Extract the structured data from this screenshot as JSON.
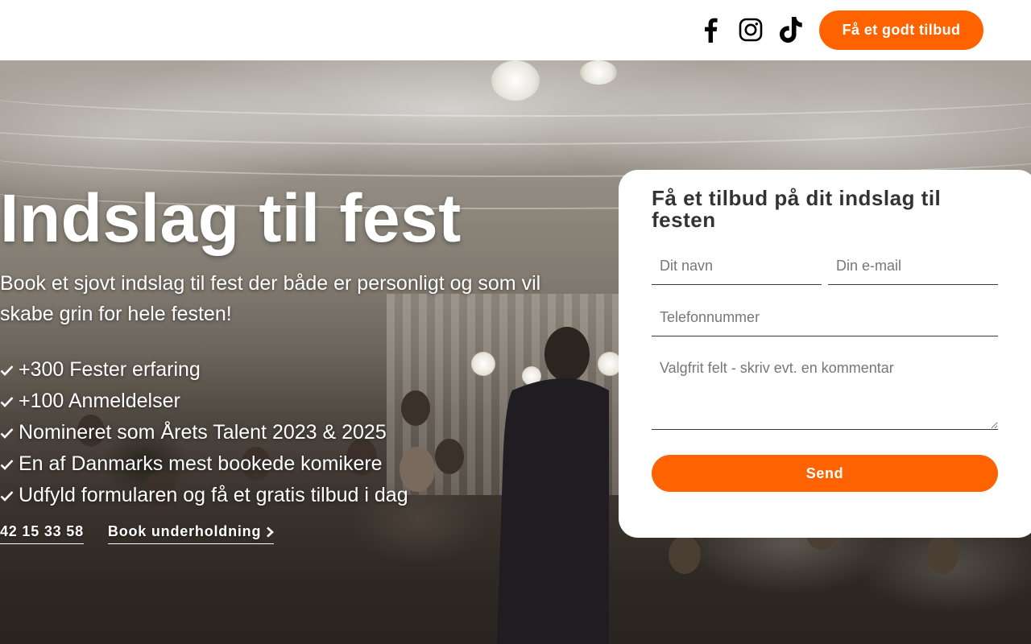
{
  "header": {
    "social": [
      {
        "name": "facebook-icon"
      },
      {
        "name": "instagram-icon"
      },
      {
        "name": "tiktok-icon"
      }
    ],
    "cta_label": "Få et godt tilbud"
  },
  "hero": {
    "title": "Indslag til fest",
    "subtitle": "Book et sjovt indslag til fest der både er personligt og som vil skabe grin for hele festen!",
    "bullets": [
      "+300 Fester erfaring",
      "+100 Anmeldelser",
      "Nomineret som Årets Talent 2023 & 2025",
      "En af Danmarks mest bookede komikere",
      "Udfyld formularen og få et gratis tilbud i dag"
    ],
    "phone_link": "42 15 33 58",
    "book_link": "Book underholdning"
  },
  "form": {
    "title": "Få et tilbud på dit indslag til festen",
    "name_placeholder": "Dit navn",
    "email_placeholder": "Din e-mail",
    "phone_placeholder": "Telefonnummer",
    "comment_placeholder": "Valgfrit felt - skriv evt. en kommentar",
    "submit_label": "Send"
  },
  "colors": {
    "accent": "#ff6300",
    "text_dark": "#333333"
  }
}
